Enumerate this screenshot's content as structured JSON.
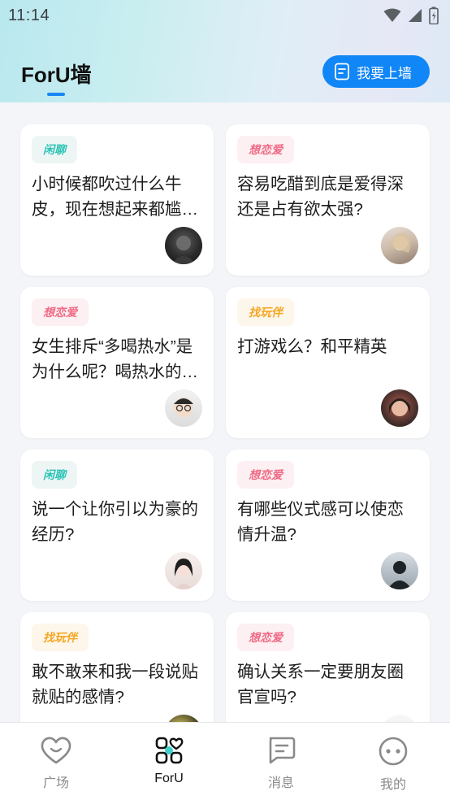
{
  "status_bar": {
    "time": "11:14"
  },
  "header": {
    "title": "ForU墙",
    "post_button_label": "我要上墙"
  },
  "cards": [
    {
      "tag": "闲聊",
      "tag_color": "#2ec4b6",
      "tag_bg": "#eef6f5",
      "text": "小时候都吹过什么牛皮，现在想起来都尴尬的那种",
      "avatar_icon": "avatar-dark-hair"
    },
    {
      "tag": "想恋爱",
      "tag_color": "#f06a86",
      "tag_bg": "#fdf0f2",
      "text": "容易吃醋到底是爱得深还是占有欲太强?",
      "avatar_icon": "avatar-blonde"
    },
    {
      "tag": "想恋爱",
      "tag_color": "#f06a86",
      "tag_bg": "#fdf0f2",
      "text": "女生排斥“多喝热水”是为什么呢？喝热水的好处",
      "avatar_icon": "avatar-glasses"
    },
    {
      "tag": "找玩伴",
      "tag_color": "#f5a623",
      "tag_bg": "#fdf6ea",
      "text": "打游戏么？和平精英",
      "avatar_icon": "avatar-selfie"
    },
    {
      "tag": "闲聊",
      "tag_color": "#2ec4b6",
      "tag_bg": "#eef6f5",
      "text": "说一个让你引以为豪的经历?",
      "avatar_icon": "avatar-girl"
    },
    {
      "tag": "想恋爱",
      "tag_color": "#f06a86",
      "tag_bg": "#fdf0f2",
      "text": "有哪些仪式感可以使恋情升温?",
      "avatar_icon": "avatar-silhouette"
    },
    {
      "tag": "找玩伴",
      "tag_color": "#f5a623",
      "tag_bg": "#fdf6ea",
      "text": "敢不敢来和我一段说贴就贴的感情?",
      "avatar_icon": "avatar-yellow"
    },
    {
      "tag": "想恋爱",
      "tag_color": "#f06a86",
      "tag_bg": "#fdf0f2",
      "text": "确认关系一定要朋友圈官宣吗?",
      "avatar_icon": "avatar-white"
    }
  ],
  "bottom_nav": [
    {
      "label": "广场",
      "icon": "heart-chat-icon",
      "active": false
    },
    {
      "label": "ForU",
      "icon": "grid-heart-icon",
      "active": true
    },
    {
      "label": "消息",
      "icon": "message-icon",
      "active": false
    },
    {
      "label": "我的",
      "icon": "face-icon",
      "active": false
    }
  ],
  "colors": {
    "accent": "#1186f6",
    "underline": "#1a86f5"
  }
}
